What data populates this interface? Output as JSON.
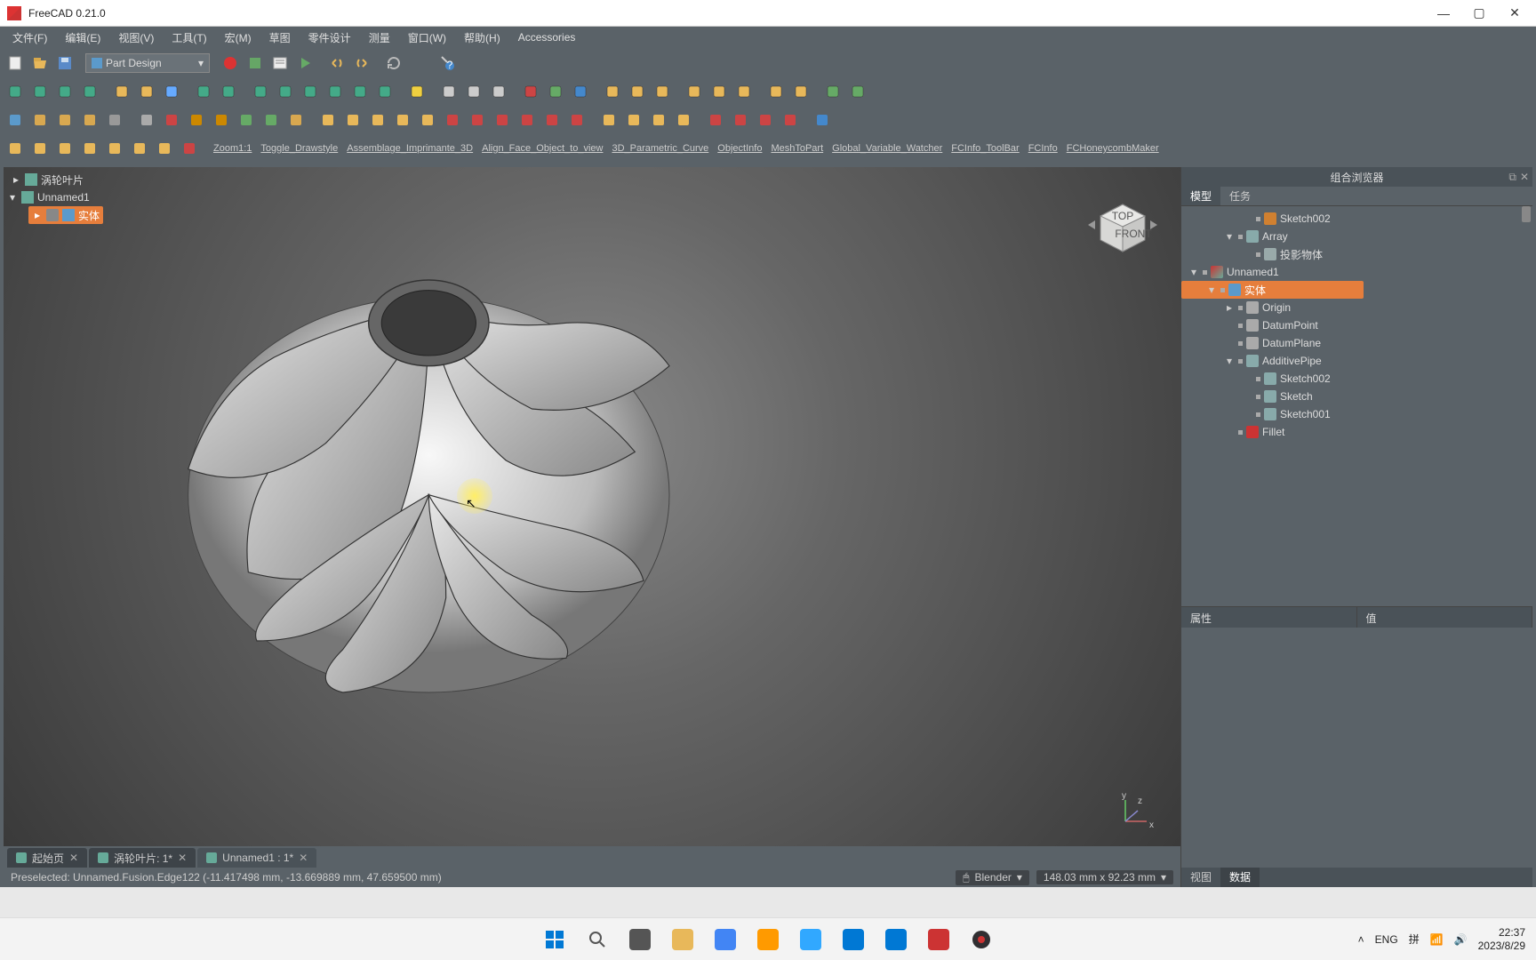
{
  "window": {
    "title": "FreeCAD 0.21.0"
  },
  "menus": [
    "文件(F)",
    "编辑(E)",
    "视图(V)",
    "工具(T)",
    "宏(M)",
    "草图",
    "零件设计",
    "测量",
    "窗口(W)",
    "帮助(H)",
    "Accessories"
  ],
  "workbench": "Part Design",
  "macro_links": [
    "Zoom1:1",
    "Toggle_Drawstyle",
    "Assemblage_Imprimante_3D",
    "Align_Face_Object_to_view",
    "3D_Parametric_Curve",
    "ObjectInfo",
    "MeshToPart",
    "Global_Variable_Watcher",
    "FCInfo_ToolBar",
    "FCInfo",
    "FCHoneycombMaker"
  ],
  "navcube": {
    "top": "TOP",
    "front": "FRONT"
  },
  "left_tree": {
    "root": "涡轮叶片",
    "doc": "Unnamed1",
    "body": "实体"
  },
  "doc_tabs": [
    {
      "label": "起始页",
      "dirty": false
    },
    {
      "label": "涡轮叶片",
      "dirty": true,
      "suffix": ": 1*"
    },
    {
      "label": "Unnamed1",
      "dirty": true,
      "suffix": " : 1*"
    }
  ],
  "statusbar": {
    "left": "Preselected: Unnamed.Fusion.Edge122 (-11.417498 mm, -13.669889 mm, 47.659500 mm)",
    "style": "Blender",
    "dims": "148.03 mm x 92.23 mm"
  },
  "combo": {
    "title": "组合浏览器",
    "tabs": [
      "模型",
      "任务"
    ],
    "prop_tabs": [
      "视图",
      "数据"
    ],
    "prop_headers": [
      "属性",
      "值"
    ],
    "tree": [
      {
        "indent": 3,
        "vis": true,
        "label": "Sketch002",
        "icon": "#d08030"
      },
      {
        "indent": 2,
        "exp": "▾",
        "vis": true,
        "label": "Array",
        "icon": "#8aa"
      },
      {
        "indent": 3,
        "vis": true,
        "label": "投影物体",
        "icon": "#9aa"
      },
      {
        "indent": 0,
        "exp": "▾",
        "vis": true,
        "label": "Unnamed1",
        "icon": "#6a9",
        "doc": true
      },
      {
        "indent": 1,
        "exp": "▾",
        "vis": true,
        "label": "实体",
        "icon": "#5b9acb",
        "sel": true
      },
      {
        "indent": 2,
        "exp": "▸",
        "vis": true,
        "label": "Origin",
        "icon": "#aaa"
      },
      {
        "indent": 2,
        "vis": true,
        "label": "DatumPoint",
        "icon": "#aaa"
      },
      {
        "indent": 2,
        "vis": true,
        "label": "DatumPlane",
        "icon": "#aaa"
      },
      {
        "indent": 2,
        "exp": "▾",
        "vis": true,
        "label": "AdditivePipe",
        "icon": "#8aa"
      },
      {
        "indent": 3,
        "vis": true,
        "label": "Sketch002",
        "icon": "#8aa"
      },
      {
        "indent": 3,
        "vis": true,
        "label": "Sketch",
        "icon": "#8aa"
      },
      {
        "indent": 3,
        "vis": true,
        "label": "Sketch001",
        "icon": "#8aa"
      },
      {
        "indent": 2,
        "vis": true,
        "label": "Fillet",
        "icon": "#c33"
      }
    ]
  },
  "taskbar": {
    "weather_temp": "",
    "lang": "ENG",
    "input": "拼",
    "time": "22:37",
    "date": "2023/8/29"
  },
  "axis": {
    "x": "x",
    "y": "y",
    "z": "z"
  }
}
